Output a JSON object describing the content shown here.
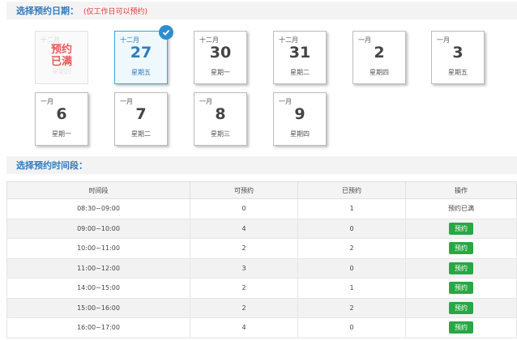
{
  "date_section": {
    "title": "选择预约日期：",
    "note": "(仅工作日可以预约)"
  },
  "time_section": {
    "title": "选择预约时间段："
  },
  "dates": [
    {
      "month": "十二月",
      "full_line1": "预约",
      "full_line2": "已满",
      "week": "星期四",
      "state": "full"
    },
    {
      "month": "十二月",
      "day": "27",
      "week": "星期五",
      "state": "selected"
    },
    {
      "month": "十二月",
      "day": "30",
      "week": "星期一",
      "state": "normal"
    },
    {
      "month": "十二月",
      "day": "31",
      "week": "星期二",
      "state": "normal"
    },
    {
      "month": "一月",
      "day": "2",
      "week": "星期四",
      "state": "normal"
    },
    {
      "month": "一月",
      "day": "3",
      "week": "星期五",
      "state": "normal"
    },
    {
      "month": "一月",
      "day": "6",
      "week": "星期一",
      "state": "normal"
    },
    {
      "month": "一月",
      "day": "7",
      "week": "星期二",
      "state": "normal"
    },
    {
      "month": "一月",
      "day": "8",
      "week": "星期三",
      "state": "normal"
    },
    {
      "month": "一月",
      "day": "9",
      "week": "星期四",
      "state": "normal"
    }
  ],
  "selected_icon": "check-circle-icon",
  "table": {
    "headers": [
      "时间段",
      "可预约",
      "已预约",
      "操作"
    ],
    "book_label": "预约",
    "rows": [
      {
        "time": "08:30~09:00",
        "available": "0",
        "booked": "1",
        "status": "预约已满"
      },
      {
        "time": "09:00~10:00",
        "available": "4",
        "booked": "0",
        "status": ""
      },
      {
        "time": "10:00~11:00",
        "available": "2",
        "booked": "2",
        "status": ""
      },
      {
        "time": "11:00~12:00",
        "available": "3",
        "booked": "0",
        "status": ""
      },
      {
        "time": "14:00~15:00",
        "available": "2",
        "booked": "1",
        "status": ""
      },
      {
        "time": "15:00~16:00",
        "available": "2",
        "booked": "2",
        "status": ""
      },
      {
        "time": "16:00~17:00",
        "available": "4",
        "booked": "0",
        "status": ""
      }
    ]
  },
  "colors": {
    "accent": "#2f7bbd",
    "button": "#28a745",
    "warning": "#e23a3a"
  }
}
